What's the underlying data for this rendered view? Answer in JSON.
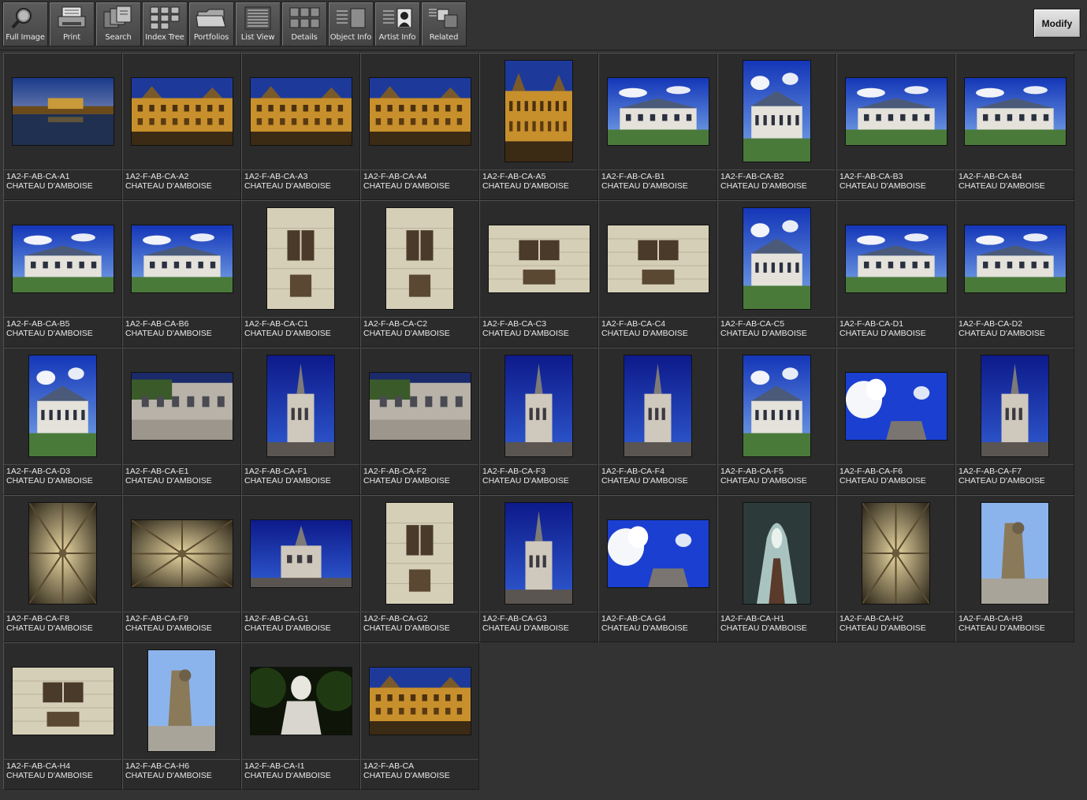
{
  "toolbar": {
    "buttons": [
      {
        "label": "Full Image",
        "icon": "magnifier-icon"
      },
      {
        "label": "Print",
        "icon": "printer-icon"
      },
      {
        "label": "Search",
        "icon": "search-stack-icon"
      },
      {
        "label": "Index Tree",
        "icon": "index-tree-icon"
      },
      {
        "label": "Portfolios",
        "icon": "folder-icon"
      },
      {
        "label": "List View",
        "icon": "list-view-icon"
      },
      {
        "label": "Details",
        "icon": "details-grid-icon"
      },
      {
        "label": "Object Info",
        "icon": "object-info-icon"
      },
      {
        "label": "Artist  Info",
        "icon": "artist-info-icon"
      },
      {
        "label": "Related",
        "icon": "related-icon"
      }
    ],
    "modify_label": "Modify"
  },
  "colors": {
    "background": "#333333",
    "cell": "#2b2b2b",
    "caption_text": "#e8e8e8"
  },
  "gallery": {
    "items": [
      {
        "id": "1A2-F-AB-CA-A1",
        "title": "CHATEAU D'AMBOISE",
        "orientation": "landscape",
        "scene": "dusk"
      },
      {
        "id": "1A2-F-AB-CA-A2",
        "title": "CHATEAU D'AMBOISE",
        "orientation": "landscape",
        "scene": "golden"
      },
      {
        "id": "1A2-F-AB-CA-A3",
        "title": "CHATEAU D'AMBOISE",
        "orientation": "landscape",
        "scene": "golden"
      },
      {
        "id": "1A2-F-AB-CA-A4",
        "title": "CHATEAU D'AMBOISE",
        "orientation": "landscape",
        "scene": "golden"
      },
      {
        "id": "1A2-F-AB-CA-A5",
        "title": "CHATEAU D'AMBOISE",
        "orientation": "portrait",
        "scene": "golden"
      },
      {
        "id": "1A2-F-AB-CA-B1",
        "title": "CHATEAU D'AMBOISE",
        "orientation": "landscape",
        "scene": "sky"
      },
      {
        "id": "1A2-F-AB-CA-B2",
        "title": "CHATEAU D'AMBOISE",
        "orientation": "portrait",
        "scene": "sky"
      },
      {
        "id": "1A2-F-AB-CA-B3",
        "title": "CHATEAU D'AMBOISE",
        "orientation": "landscape",
        "scene": "sky"
      },
      {
        "id": "1A2-F-AB-CA-B4",
        "title": "CHATEAU D'AMBOISE",
        "orientation": "landscape",
        "scene": "sky"
      },
      {
        "id": "1A2-F-AB-CA-B5",
        "title": "CHATEAU D'AMBOISE",
        "orientation": "landscape",
        "scene": "sky"
      },
      {
        "id": "1A2-F-AB-CA-B6",
        "title": "CHATEAU D'AMBOISE",
        "orientation": "landscape",
        "scene": "sky"
      },
      {
        "id": "1A2-F-AB-CA-C1",
        "title": "CHATEAU D'AMBOISE",
        "orientation": "portrait",
        "scene": "stone"
      },
      {
        "id": "1A2-F-AB-CA-C2",
        "title": "CHATEAU D'AMBOISE",
        "orientation": "portrait",
        "scene": "stone"
      },
      {
        "id": "1A2-F-AB-CA-C3",
        "title": "CHATEAU D'AMBOISE",
        "orientation": "landscape",
        "scene": "stone"
      },
      {
        "id": "1A2-F-AB-CA-C4",
        "title": "CHATEAU D'AMBOISE",
        "orientation": "landscape",
        "scene": "stone"
      },
      {
        "id": "1A2-F-AB-CA-C5",
        "title": "CHATEAU D'AMBOISE",
        "orientation": "portrait",
        "scene": "sky"
      },
      {
        "id": "1A2-F-AB-CA-D1",
        "title": "CHATEAU D'AMBOISE",
        "orientation": "landscape",
        "scene": "sky"
      },
      {
        "id": "1A2-F-AB-CA-D2",
        "title": "CHATEAU D'AMBOISE",
        "orientation": "landscape",
        "scene": "sky"
      },
      {
        "id": "1A2-F-AB-CA-D3",
        "title": "CHATEAU D'AMBOISE",
        "orientation": "portrait",
        "scene": "sky"
      },
      {
        "id": "1A2-F-AB-CA-E1",
        "title": "CHATEAU D'AMBOISE",
        "orientation": "landscape",
        "scene": "street"
      },
      {
        "id": "1A2-F-AB-CA-F1",
        "title": "CHATEAU D'AMBOISE",
        "orientation": "portrait",
        "scene": "deepsky"
      },
      {
        "id": "1A2-F-AB-CA-F2",
        "title": "CHATEAU D'AMBOISE",
        "orientation": "landscape",
        "scene": "street"
      },
      {
        "id": "1A2-F-AB-CA-F3",
        "title": "CHATEAU D'AMBOISE",
        "orientation": "portrait",
        "scene": "deepsky"
      },
      {
        "id": "1A2-F-AB-CA-F4",
        "title": "CHATEAU D'AMBOISE",
        "orientation": "portrait",
        "scene": "deepsky"
      },
      {
        "id": "1A2-F-AB-CA-F5",
        "title": "CHATEAU D'AMBOISE",
        "orientation": "portrait",
        "scene": "sky"
      },
      {
        "id": "1A2-F-AB-CA-F6",
        "title": "CHATEAU D'AMBOISE",
        "orientation": "landscape",
        "scene": "clouds"
      },
      {
        "id": "1A2-F-AB-CA-F7",
        "title": "CHATEAU D'AMBOISE",
        "orientation": "portrait",
        "scene": "deepsky"
      },
      {
        "id": "1A2-F-AB-CA-F8",
        "title": "CHATEAU D'AMBOISE",
        "orientation": "portrait",
        "scene": "vault"
      },
      {
        "id": "1A2-F-AB-CA-F9",
        "title": "CHATEAU D'AMBOISE",
        "orientation": "landscape",
        "scene": "vault"
      },
      {
        "id": "1A2-F-AB-CA-G1",
        "title": "CHATEAU D'AMBOISE",
        "orientation": "landscape",
        "scene": "deepsky"
      },
      {
        "id": "1A2-F-AB-CA-G2",
        "title": "CHATEAU D'AMBOISE",
        "orientation": "portrait",
        "scene": "stone"
      },
      {
        "id": "1A2-F-AB-CA-G3",
        "title": "CHATEAU D'AMBOISE",
        "orientation": "portrait",
        "scene": "deepsky"
      },
      {
        "id": "1A2-F-AB-CA-G4",
        "title": "CHATEAU D'AMBOISE",
        "orientation": "landscape",
        "scene": "clouds"
      },
      {
        "id": "1A2-F-AB-CA-H1",
        "title": "CHATEAU D'AMBOISE",
        "orientation": "portrait",
        "scene": "corridor"
      },
      {
        "id": "1A2-F-AB-CA-H2",
        "title": "CHATEAU D'AMBOISE",
        "orientation": "portrait",
        "scene": "vault"
      },
      {
        "id": "1A2-F-AB-CA-H3",
        "title": "CHATEAU D'AMBOISE",
        "orientation": "portrait",
        "scene": "lightsky"
      },
      {
        "id": "1A2-F-AB-CA-H4",
        "title": "CHATEAU D'AMBOISE",
        "orientation": "landscape",
        "scene": "stone"
      },
      {
        "id": "1A2-F-AB-CA-H6",
        "title": "CHATEAU D'AMBOISE",
        "orientation": "portrait",
        "scene": "lightsky"
      },
      {
        "id": "1A2-F-AB-CA-I1",
        "title": "CHATEAU D'AMBOISE",
        "orientation": "landscape",
        "scene": "bust"
      },
      {
        "id": "1A2-F-AB-CA",
        "title": "CHATEAU D'AMBOISE",
        "orientation": "landscape",
        "scene": "golden"
      }
    ]
  }
}
